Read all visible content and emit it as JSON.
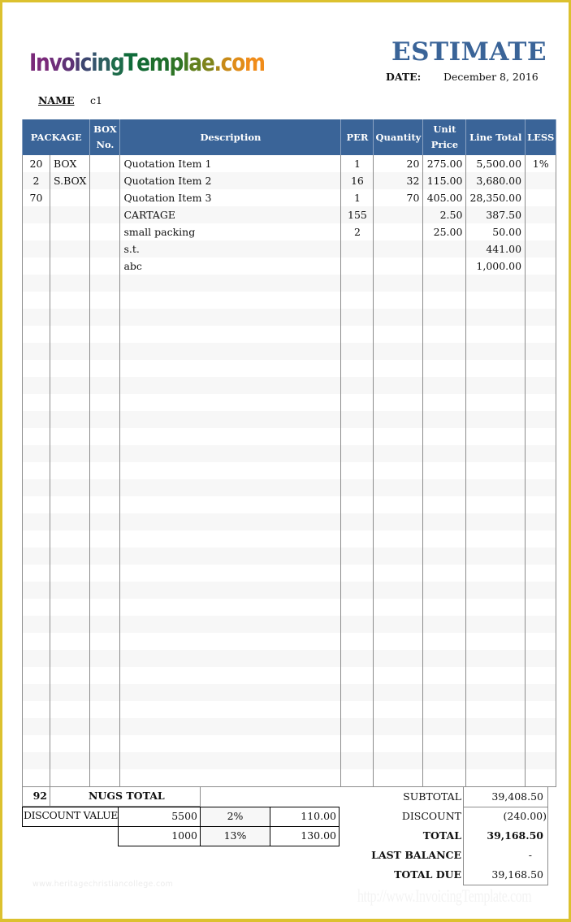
{
  "logo": {
    "text": "InvoicingTemplae.com",
    "letters": [
      {
        "ch": "I",
        "color": "#7a2a7a"
      },
      {
        "ch": "n",
        "color": "#7a2a7a"
      },
      {
        "ch": "v",
        "color": "#6f2e7a"
      },
      {
        "ch": "o",
        "color": "#5e3276"
      },
      {
        "ch": "i",
        "color": "#4c3a72"
      },
      {
        "ch": "c",
        "color": "#3c4670"
      },
      {
        "ch": "i",
        "color": "#35546c"
      },
      {
        "ch": "n",
        "color": "#2c5f5e"
      },
      {
        "ch": "g",
        "color": "#1d6b4a"
      },
      {
        "ch": "T",
        "color": "#0f6b3a"
      },
      {
        "ch": "e",
        "color": "#126a33"
      },
      {
        "ch": "m",
        "color": "#1d6e2c"
      },
      {
        "ch": "p",
        "color": "#2e7426"
      },
      {
        "ch": "l",
        "color": "#457a22"
      },
      {
        "ch": "a",
        "color": "#62801f"
      },
      {
        "ch": "e",
        "color": "#7f841c"
      },
      {
        "ch": ".",
        "color": "#a8861a"
      },
      {
        "ch": "c",
        "color": "#c88a18"
      },
      {
        "ch": "o",
        "color": "#e08c18"
      },
      {
        "ch": "m",
        "color": "#f08c1a"
      }
    ]
  },
  "header": {
    "title": "ESTIMATE",
    "date_label": "DATE:",
    "date_value": "December 8, 2016",
    "name_label": "NAME",
    "name_value": "c1"
  },
  "colors": {
    "accent": "#3a6498",
    "frame": "#dcc12f"
  },
  "table": {
    "columns": [
      "PACKAGE",
      "BOX No.",
      "Description",
      "PER",
      "Quantity",
      "Unit Price",
      "Line Total",
      "LESS"
    ],
    "col_headers": {
      "package": "PACKAGE",
      "box_no_line1": "BOX",
      "box_no_line2": "No.",
      "description": "Description",
      "per": "PER",
      "quantity": "Quantity",
      "unit_price_line1": "Unit",
      "unit_price_line2": "Price",
      "line_total": "Line Total",
      "less": "LESS"
    },
    "rows": [
      {
        "pkg_qty": "20",
        "pkg_type": "BOX",
        "box_no": "",
        "description": "Quotation Item 1",
        "per": "1",
        "quantity": "20",
        "unit_price": "275.00",
        "line_total": "5,500.00",
        "less": "1%"
      },
      {
        "pkg_qty": "2",
        "pkg_type": "S.BOX",
        "box_no": "",
        "description": "Quotation Item 2",
        "per": "16",
        "quantity": "32",
        "unit_price": "115.00",
        "line_total": "3,680.00",
        "less": ""
      },
      {
        "pkg_qty": "70",
        "pkg_type": "",
        "box_no": "",
        "description": "Quotation Item 3",
        "per": "1",
        "quantity": "70",
        "unit_price": "405.00",
        "line_total": "28,350.00",
        "less": ""
      },
      {
        "pkg_qty": "",
        "pkg_type": "",
        "box_no": "",
        "description": "CARTAGE",
        "per": "155",
        "quantity": "",
        "unit_price": "2.50",
        "line_total": "387.50",
        "less": ""
      },
      {
        "pkg_qty": "",
        "pkg_type": "",
        "box_no": "",
        "description": "small packing",
        "per": "2",
        "quantity": "",
        "unit_price": "25.00",
        "line_total": "50.00",
        "less": ""
      },
      {
        "pkg_qty": "",
        "pkg_type": "",
        "box_no": "",
        "description": "s.t.",
        "per": "",
        "quantity": "",
        "unit_price": "",
        "line_total": "441.00",
        "less": ""
      },
      {
        "pkg_qty": "",
        "pkg_type": "",
        "box_no": "",
        "description": "abc",
        "per": "",
        "quantity": "",
        "unit_price": "",
        "line_total": "1,000.00",
        "less": ""
      }
    ],
    "empty_row_count": 30
  },
  "footer": {
    "nugs_total_value": "92",
    "nugs_total_label": "NUGS TOTAL",
    "discount_value_label": "DISCOUNT VALUE",
    "discount_rows": [
      {
        "base": "5500",
        "percent": "2%",
        "amount": "110.00"
      },
      {
        "base": "1000",
        "percent": "13%",
        "amount": "130.00"
      }
    ],
    "summary": [
      {
        "label": "SUBTOTAL",
        "value": "39,408.50",
        "bold": false
      },
      {
        "label": "DISCOUNT",
        "value": "(240.00)",
        "bold": false
      },
      {
        "label": "TOTAL",
        "value": "39,168.50",
        "bold": true
      },
      {
        "label": "LAST BALANCE",
        "value": "-",
        "bold": false
      },
      {
        "label": "TOTAL DUE",
        "value": "39,168.50",
        "bold": false
      }
    ]
  },
  "watermarks": {
    "left": "www.heritagechristiancollege.com",
    "right": "http://www.InvoicingTemplate.com"
  }
}
